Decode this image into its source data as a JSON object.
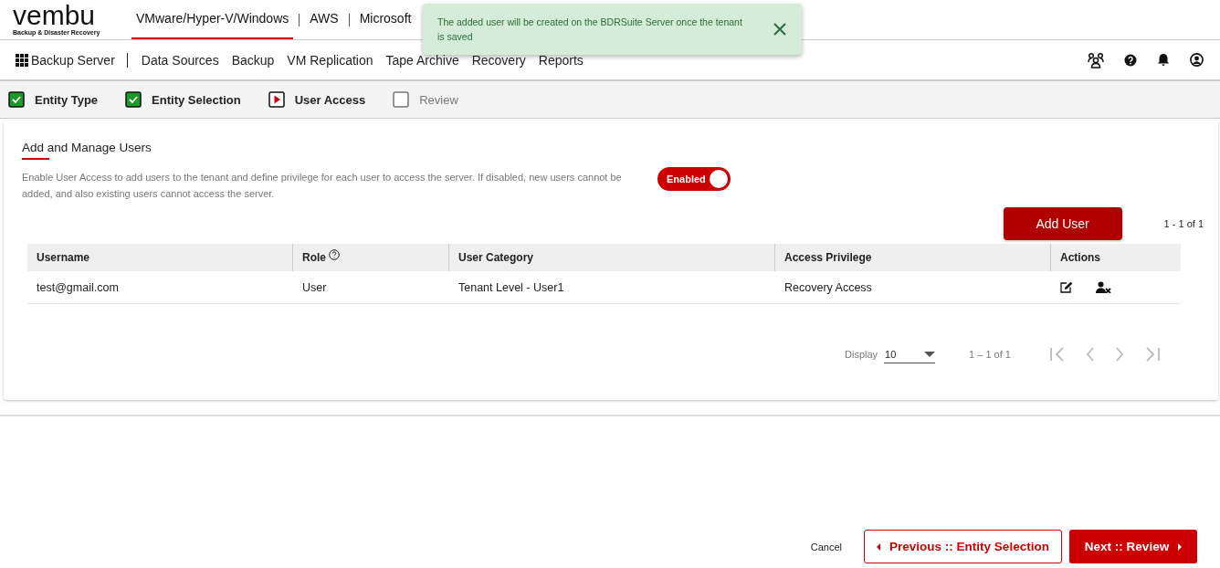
{
  "logo": {
    "wordmark": "vembu",
    "tagline": "Backup & Disaster Recovery"
  },
  "platform_tabs": [
    {
      "label": "VMware/Hyper-V/Windows",
      "selected": true
    },
    {
      "label": "AWS",
      "selected": false
    },
    {
      "label": "Microsoft",
      "selected": false
    }
  ],
  "toast": {
    "message": "The added user will be created on the BDRSuite Server once the tenant is saved"
  },
  "product": "Backup Server",
  "menu": [
    "Data Sources",
    "Backup",
    "VM Replication",
    "Tape Archive",
    "Recovery",
    "Reports"
  ],
  "steps": [
    {
      "label": "Entity Type",
      "kind": "done"
    },
    {
      "label": "Entity Selection",
      "kind": "done"
    },
    {
      "label": "User Access",
      "kind": "current"
    },
    {
      "label": "Review",
      "kind": "pending"
    }
  ],
  "section": {
    "title": "Add and Manage Users",
    "description": "Enable User Access to add users to the tenant and define privilege for each user to access the server. If disabled, new users cannot be added, and also existing users cannot access the server.",
    "toggle": {
      "label": "Enabled",
      "on": true
    }
  },
  "add_button": "Add User",
  "top_range": "1 - 1 of 1",
  "table": {
    "columns": [
      "Username",
      "Role",
      "User Category",
      "Access Privilege",
      "Actions"
    ],
    "rows": [
      [
        "test@gmail.com",
        "User",
        "Tenant Level - User1",
        "Recovery Access"
      ]
    ]
  },
  "pager": {
    "display_label": "Display",
    "page_size": "10",
    "range": "1 – 1 of 1"
  },
  "footer": {
    "cancel": "Cancel",
    "previous": "Previous :: Entity Selection",
    "next": "Next :: Review"
  }
}
